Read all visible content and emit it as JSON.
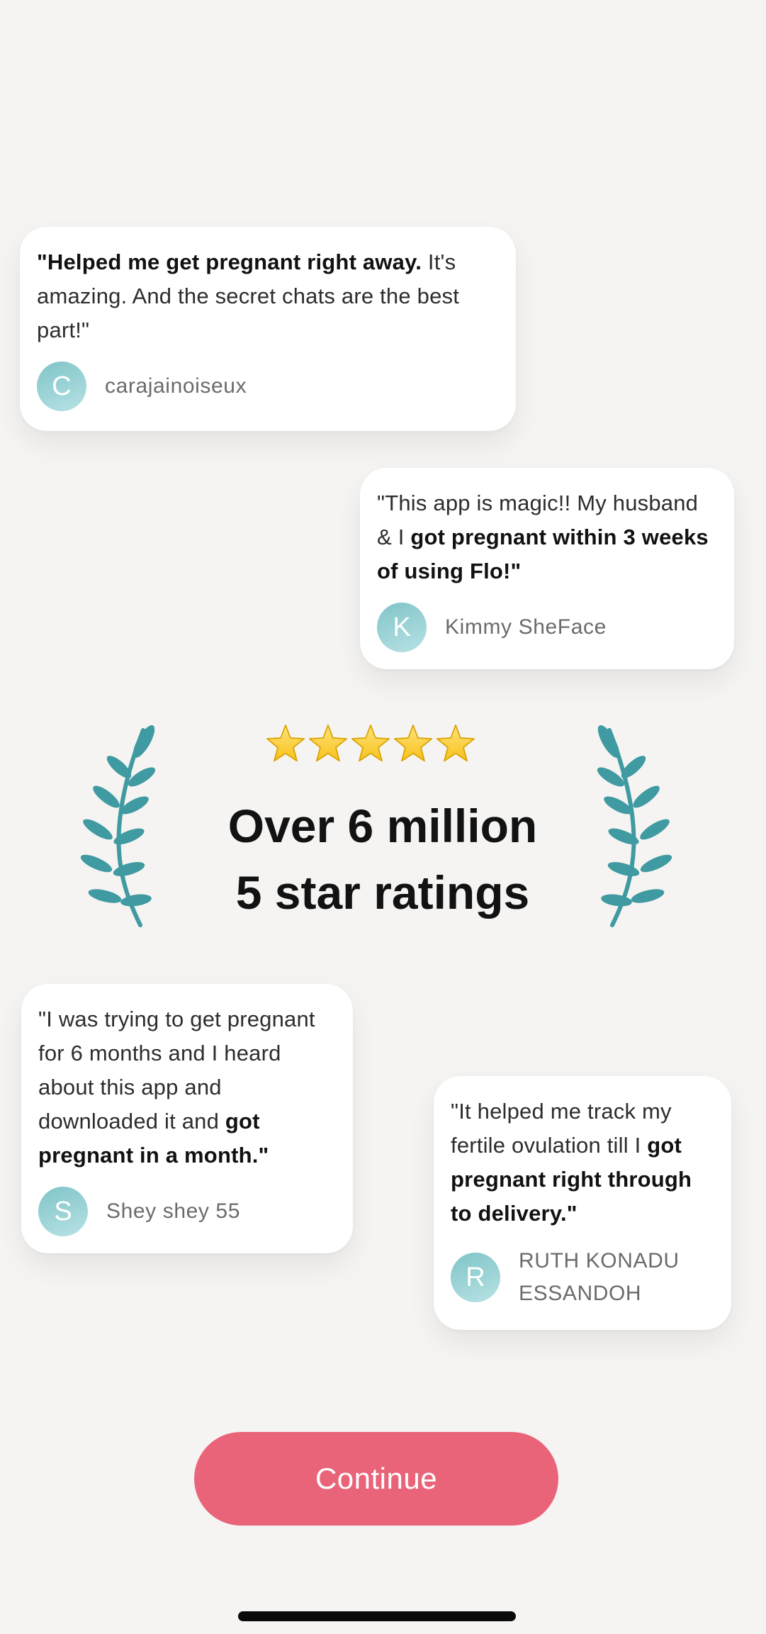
{
  "reviews": [
    {
      "quote_parts": [
        {
          "text": "\"Helped me get pregnant right away. ",
          "bold": true
        },
        {
          "text": "It's amazing. And the secret chats are the best part!\"",
          "bold": false
        }
      ],
      "author": "carajainoiseux",
      "initial": "C"
    },
    {
      "quote_parts": [
        {
          "text": "\"This app is magic!! My husband & I ",
          "bold": false
        },
        {
          "text": "got pregnant within 3 weeks of using Flo!\"",
          "bold": true
        }
      ],
      "author": "Kimmy SheFace",
      "initial": "K"
    },
    {
      "quote_parts": [
        {
          "text": "\"I was trying to get pregnant for 6 months and I heard about this app and downloaded it and ",
          "bold": false
        },
        {
          "text": "got pregnant in a month.\"",
          "bold": true
        }
      ],
      "author": "Shey shey 55",
      "initial": "S"
    },
    {
      "quote_parts": [
        {
          "text": "\"It helped me track my fertile ovulation till I ",
          "bold": false
        },
        {
          "text": "got pregnant right through to delivery.\"",
          "bold": true
        }
      ],
      "author": "RUTH KONADU ESSANDOH",
      "initial": "R"
    }
  ],
  "rating": {
    "stars": 5,
    "star_max": 5,
    "headline_line1": "Over 6 million",
    "headline_line2": "5 star ratings"
  },
  "continue_label": "Continue",
  "colors": {
    "background": "#f5f4f2",
    "button": "#ea6479",
    "laurel": "#3f9aa1",
    "avatar": "#7fc4c8",
    "star": "#f7c21b"
  },
  "icons": {
    "stars": "star-icon",
    "laurels": "laurel-icon",
    "avatars": "avatar-initial"
  }
}
